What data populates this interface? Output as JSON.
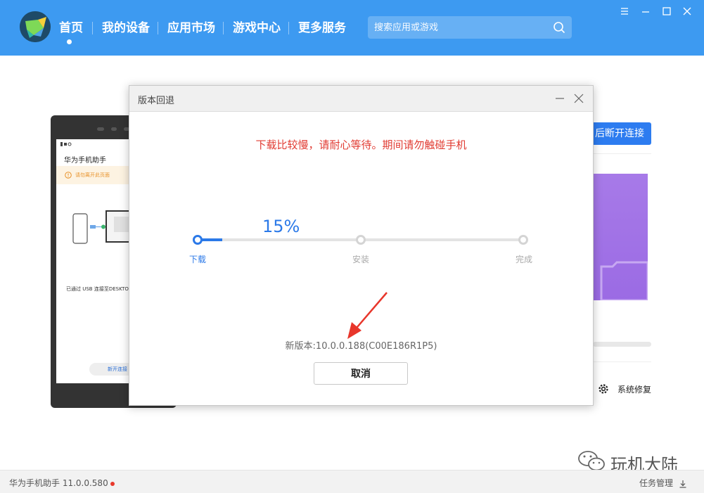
{
  "header": {
    "nav": [
      {
        "label": "首页",
        "active": true
      },
      {
        "label": "我的设备",
        "active": false
      },
      {
        "label": "应用市场",
        "active": false
      },
      {
        "label": "游戏中心",
        "active": false
      },
      {
        "label": "更多服务",
        "active": false
      }
    ],
    "search_placeholder": "搜索应用或游戏"
  },
  "phone": {
    "title": "华为手机助手",
    "warning": "请勿离开此页面",
    "usb_text": "已通过 USB 连接至DESKTO",
    "button": "新开连接"
  },
  "background": {
    "disconnect_button": "后断开连接",
    "repair_label": "系统修复"
  },
  "dialog": {
    "title": "版本回退",
    "warning": "下载比较慢，请耐心等待。期间请勿触碰手机",
    "progress_percent": "15%",
    "progress_value": 15,
    "steps": [
      {
        "label": "下载",
        "active": true
      },
      {
        "label": "安装",
        "active": false
      },
      {
        "label": "完成",
        "active": false
      }
    ],
    "version": "新版本:10.0.0.188(C00E186R1P5)",
    "cancel_label": "取消"
  },
  "status": {
    "app_version": "华为手机助手 11.0.0.580",
    "task_manager": "任务管理"
  },
  "watermark": {
    "text": "玩机大陆"
  },
  "colors": {
    "header_bg": "#3d9af1",
    "accent": "#2b79e8",
    "warning_red": "#e13b32"
  }
}
